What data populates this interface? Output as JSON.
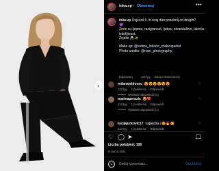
{
  "header": {
    "username": "inka.vp",
    "separator": "•",
    "follow_label": "Obserwuj",
    "more_icon": "more-icon"
  },
  "caption": {
    "username": "inka.vp",
    "lines": [
      "Osjećaš li i ti ovaj dan posebnij od drugih?",
      "💜",
      "Žene su ljepota, razigranost, ljubav, stvaralaštvo, lakoća,",
      "izdržljivost.",
      "Žvjelie 🥂✨"
    ],
    "makeup_label": "Make up:",
    "makeup_handle": "@estera_lukacic_makeupartist",
    "photo_label": "Photo credits:",
    "photo_handle": "@nate_photography",
    "meta": [
      "Edytowany",
      "·",
      "113 tyg.",
      "Zobacz tłumaczenie"
    ]
  },
  "comments": [
    {
      "username": "milanajeldovac",
      "text": "😍😍😍😍😍😍",
      "time": "113 tyg.",
      "likes": "1 polubienie",
      "reply_label": "Odpowiedz",
      "replies_label": "Wyświetl odpowiedzi (1)",
      "avatar_color": "#5a3e36"
    },
    {
      "username": "marinaperazic",
      "text": "😍❤️",
      "time": "113 tyg.",
      "likes": "1 polubienie",
      "reply_label": "Odpowiedz",
      "replies_label": "Wyświetl odpowiedzi (1)",
      "avatar_color": "#8a6a52"
    },
    {
      "username": "lucijajurkovic17",
      "text": "najljepša i 😍🔥😍",
      "time": "113 tyg.",
      "likes": "1 polubienie",
      "reply_label": "Odpowiedz",
      "replies_label": "",
      "avatar_color": "#6d4c3d"
    }
  ],
  "actions": {
    "like_icon": "heart-icon",
    "comment_icon": "comment-icon",
    "share_icon": "send-icon",
    "save_icon": "bookmark-icon"
  },
  "likes_text": "Liczba polubień: 106",
  "date_text": "8 marca 2024",
  "add_comment": {
    "placeholder": "Dodaj komentarz...",
    "post_label": "Opublikuj"
  },
  "colors": {
    "accent_link": "#4a9dff",
    "background": "#000000",
    "photo_background": "#ececec"
  }
}
